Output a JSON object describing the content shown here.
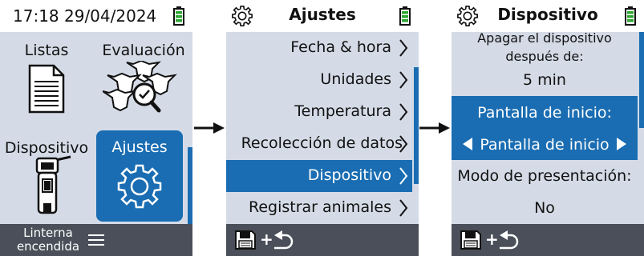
{
  "screen1": {
    "clock": "17:18 29/04/2024",
    "tiles": {
      "lists": "Listas",
      "evaluation": "Evaluación",
      "device": "Dispositivo",
      "settings": "Ajustes"
    },
    "footer_lines": [
      "Linterna",
      "encendida"
    ]
  },
  "screen2": {
    "title": "Ajustes",
    "items": [
      "Fecha & hora",
      "Unidades",
      "Temperatura",
      "Recolección de datos",
      "Dispositivo",
      "Registrar animales"
    ],
    "selected_index": 4
  },
  "screen3": {
    "title": "Dispositivo",
    "shutdown_line1": "Apagar el dispositivo",
    "shutdown_line2": "después de:",
    "shutdown_value": "5 min",
    "home_label": "Pantalla de inicio:",
    "home_value": "Pantalla de inicio",
    "mode_label": "Modo de presentación:",
    "mode_value": "No"
  },
  "icons": [
    "battery-icon",
    "gear-icon",
    "chevron-right-icon",
    "menu-icon",
    "save-icon",
    "back-arrow-icon",
    "arrow-right-icon",
    "document-list-icon",
    "cows-evaluation-icon",
    "handheld-device-icon"
  ],
  "colors": {
    "accent": "#1a6db2",
    "panel": "#d4dbe6",
    "footer": "#4a4f5a",
    "battery": "#2ea532"
  }
}
